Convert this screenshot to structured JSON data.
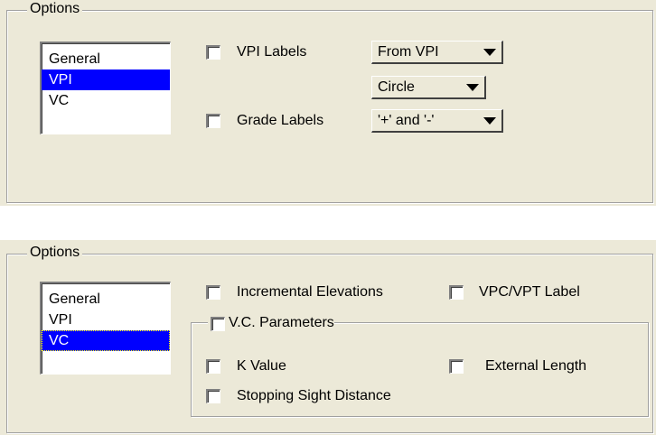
{
  "panel1": {
    "group_title": "Options",
    "list_items": [
      {
        "label": "General",
        "selected": false
      },
      {
        "label": "VPI",
        "selected": true
      },
      {
        "label": "VC",
        "selected": false
      }
    ],
    "vpi_labels": {
      "label": "VPI Labels",
      "checked": false,
      "dropdown_value": "From VPI"
    },
    "shape_dropdown_value": "Circle",
    "grade_labels": {
      "label": "Grade Labels",
      "checked": false,
      "dropdown_value": "'+' and '-'"
    }
  },
  "panel2": {
    "group_title": "Options",
    "list_items": [
      {
        "label": "General",
        "selected": false
      },
      {
        "label": "VPI",
        "selected": false
      },
      {
        "label": "VC",
        "selected": true
      }
    ],
    "incremental_elevations": {
      "label": "Incremental Elevations",
      "checked": false
    },
    "vpc_vpt_label": {
      "label": "VPC/VPT Label",
      "checked": false
    },
    "vc_parameters": {
      "title": "V.C. Parameters",
      "checked": false,
      "k_value": {
        "label": "K Value",
        "checked": false
      },
      "external_length": {
        "label": "External Length",
        "checked": false
      },
      "stopping_sight_distance": {
        "label": "Stopping Sight Distance",
        "checked": false
      }
    }
  },
  "colors": {
    "selection": "#0000ff",
    "panel_bg": "#ece9d8"
  }
}
